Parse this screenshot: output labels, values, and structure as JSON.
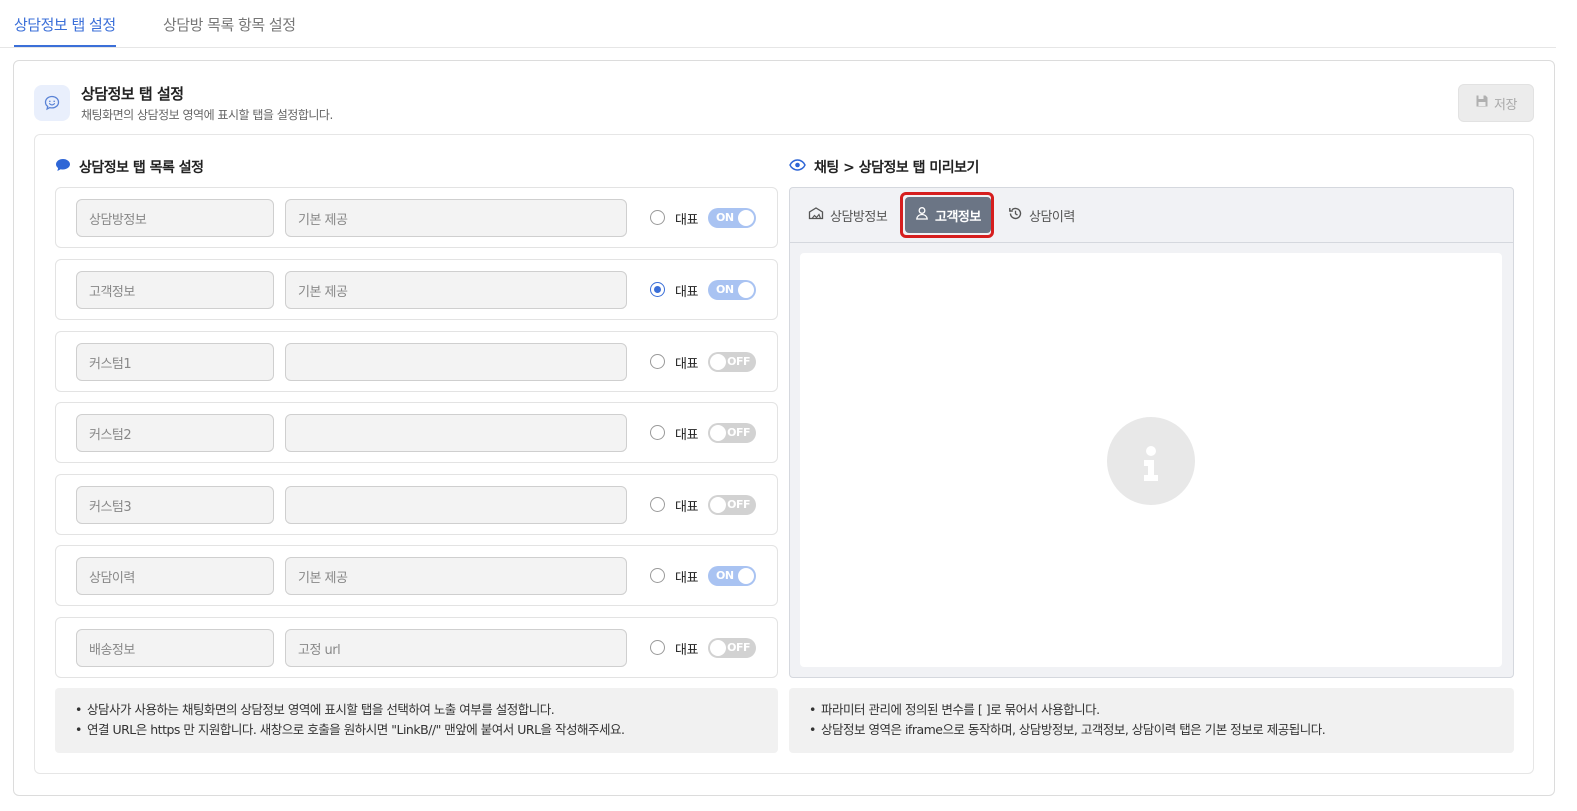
{
  "top_tabs": [
    {
      "label": "상담정보 탭 설정",
      "active": true
    },
    {
      "label": "상담방 목록 항목 설정",
      "active": false
    }
  ],
  "card": {
    "icon": "chat-smile-icon",
    "title": "상담정보 탭 설정",
    "description": "채팅화면의 상담정보 영역에 표시할 탭을 설정합니다.",
    "save_label": "저장",
    "save_icon": "floppy-disk-icon"
  },
  "list_section": {
    "icon": "speech-bubble-icon",
    "title": "상담정보 탭 목록 설정",
    "representative_label": "대표",
    "rows": [
      {
        "name": "상담방정보",
        "url": "기본 제공",
        "representative": false,
        "toggle": "ON"
      },
      {
        "name": "고객정보",
        "url": "기본 제공",
        "representative": true,
        "toggle": "ON"
      },
      {
        "name": "커스텀1",
        "url": "",
        "representative": false,
        "toggle": "OFF"
      },
      {
        "name": "커스텀2",
        "url": "",
        "representative": false,
        "toggle": "OFF"
      },
      {
        "name": "커스텀3",
        "url": "",
        "representative": false,
        "toggle": "OFF"
      },
      {
        "name": "상담이력",
        "url": "기본 제공",
        "representative": false,
        "toggle": "ON"
      },
      {
        "name": "배송정보",
        "url": "고정 url",
        "representative": false,
        "toggle": "OFF"
      }
    ]
  },
  "preview_section": {
    "icon": "eye-icon",
    "title": "채팅 > 상담정보 탭 미리보기",
    "tabs": [
      {
        "label": "상담방정보",
        "icon": "room-icon",
        "active": false
      },
      {
        "label": "고객정보",
        "icon": "user-icon",
        "active": true
      },
      {
        "label": "상담이력",
        "icon": "history-icon",
        "active": false
      }
    ],
    "body_icon": "info-icon"
  },
  "notes_left": [
    "상담사가 사용하는 채팅화면의 상담정보 영역에 표시할 탭을 선택하여 노출 여부를 설정합니다.",
    "연결 URL은 https 만 지원합니다. 새창으로 호출을 원하시면 \"LinkB//\" 맨앞에 붙여서 URL을 작성해주세요."
  ],
  "notes_right": [
    "파라미터 관리에 정의된 변수를 [ ]로 묶어서 사용합니다.",
    "상담정보 영역은 iframe으로 동작하며, 상담방정보, 고객정보, 상담이력 탭은 기본 정보로 제공됩니다."
  ],
  "colors": {
    "accent": "#3b6fd8",
    "toggle_on": "#a9c3f2",
    "toggle_off": "#d2d2d2",
    "active_tab": "#6b7585",
    "highlight": "#d61e1e"
  }
}
